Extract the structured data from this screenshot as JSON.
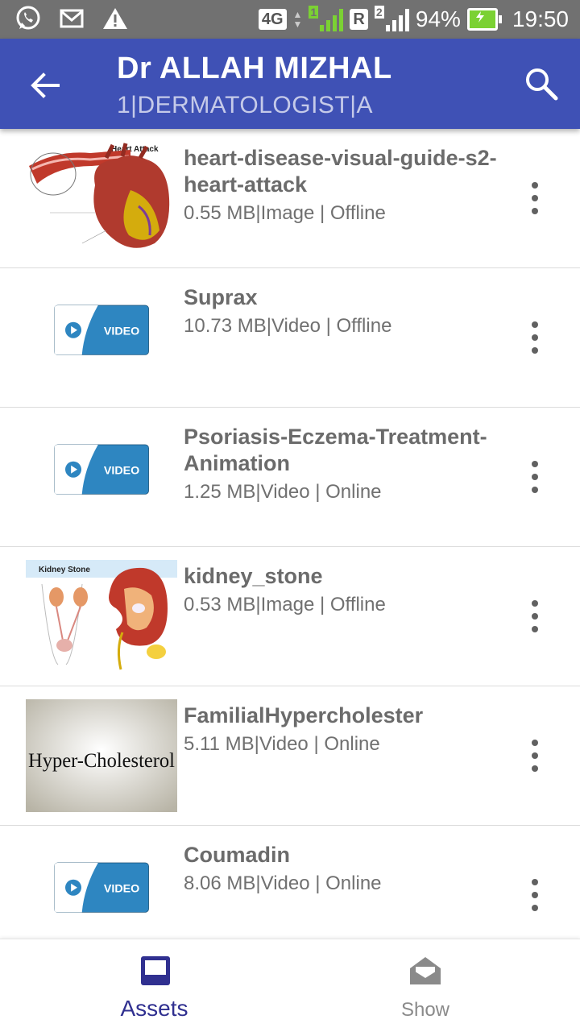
{
  "status_bar": {
    "network_label": "4G",
    "sim1_label": "1",
    "roaming_label": "R",
    "sim2_label": "2",
    "battery_percent": "94%",
    "time": "19:50",
    "icons": [
      "whatsapp-icon",
      "mail-icon",
      "warning-icon"
    ]
  },
  "app_bar": {
    "title": "Dr ALLAH MIZHAL",
    "subtitle": "1|DERMATOLOGIST|A",
    "back_icon": "arrow-back-icon",
    "search_icon": "search-icon"
  },
  "assets": [
    {
      "name": "heart-disease-visual-guide-s2-heart-attack",
      "meta": "0.55 MB|Image | Offline",
      "thumb": "heart-attack",
      "thumb_caption": "Heart Attack"
    },
    {
      "name": "Suprax",
      "meta": "10.73 MB|Video | Offline",
      "thumb": "video",
      "thumb_caption": "VIDEO"
    },
    {
      "name": "Psoriasis-Eczema-Treatment-Animation",
      "meta": "1.25 MB|Video | Online",
      "thumb": "video",
      "thumb_caption": "VIDEO"
    },
    {
      "name": "kidney_stone",
      "meta": "0.53 MB|Image | Offline",
      "thumb": "kidney",
      "thumb_caption": "Kidney Stone"
    },
    {
      "name": "FamilialHypercholester",
      "meta": "5.11 MB|Video | Online",
      "thumb": "cholesterol",
      "thumb_caption": "Hyper-Cholesterol"
    },
    {
      "name": "Coumadin",
      "meta": "8.06 MB|Video | Online",
      "thumb": "video",
      "thumb_caption": "VIDEO"
    }
  ],
  "bottom_nav": {
    "tabs": [
      {
        "label": "Assets",
        "icon": "inbox-icon",
        "active": true
      },
      {
        "label": "Show",
        "icon": "open-envelope-icon",
        "active": false
      }
    ]
  },
  "colors": {
    "primary": "#3f51b5",
    "status_bar": "#717171",
    "active_tab": "#303090",
    "video_thumb": "#2e86c1"
  }
}
